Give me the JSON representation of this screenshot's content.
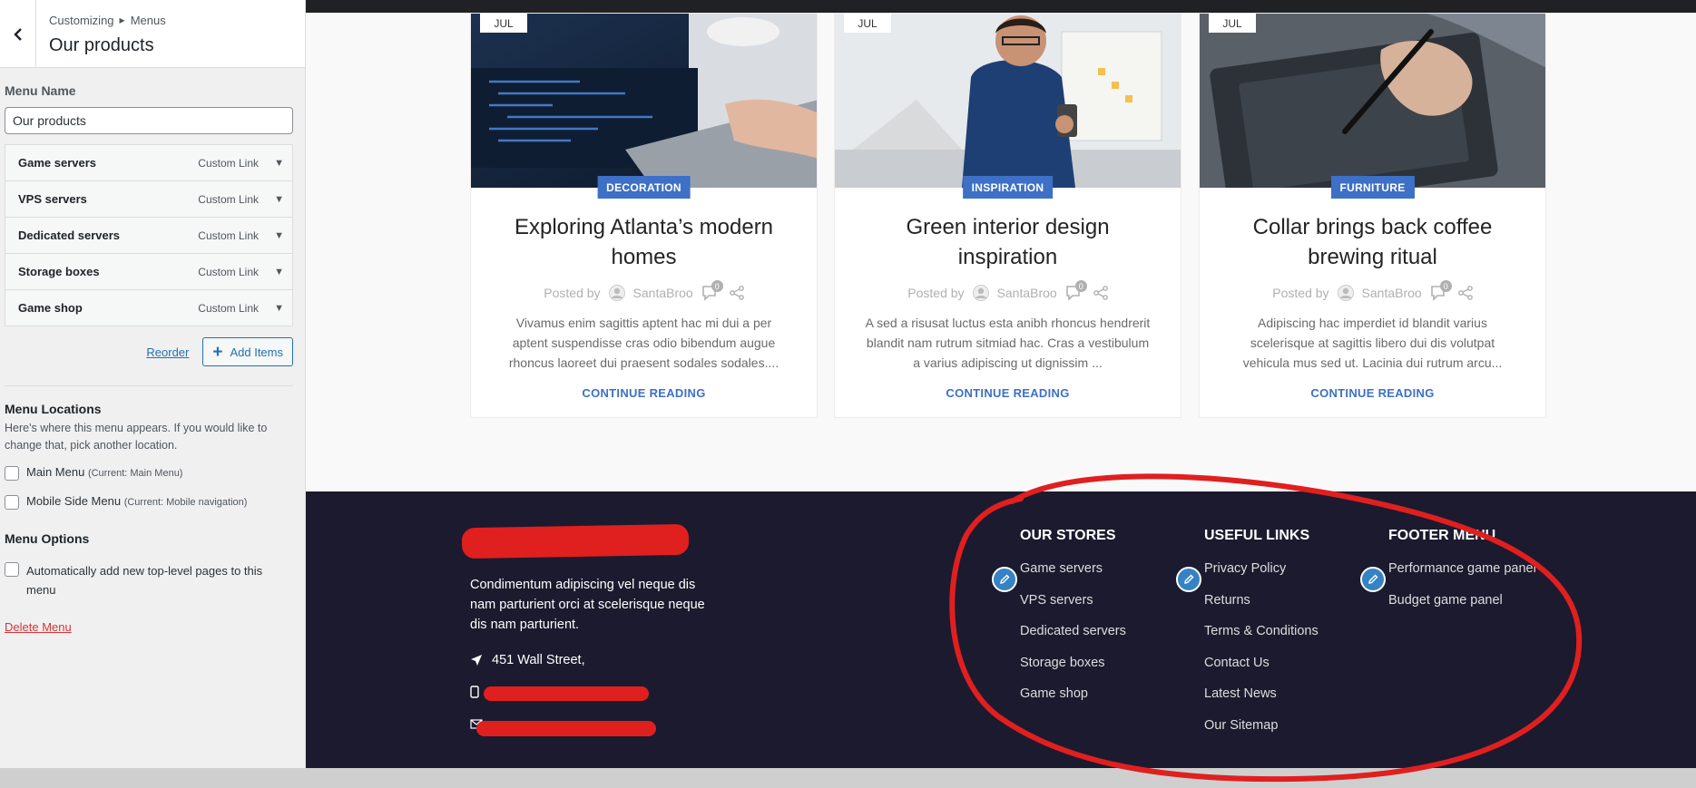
{
  "sidebar": {
    "breadcrumb": {
      "parent": "Customizing",
      "current": "Menus"
    },
    "title": "Our products",
    "menu_name_label": "Menu Name",
    "menu_name_value": "Our products",
    "items": [
      {
        "title": "Game servers",
        "type": "Custom Link"
      },
      {
        "title": "VPS servers",
        "type": "Custom Link"
      },
      {
        "title": "Dedicated servers",
        "type": "Custom Link"
      },
      {
        "title": "Storage boxes",
        "type": "Custom Link"
      },
      {
        "title": "Game shop",
        "type": "Custom Link"
      }
    ],
    "reorder_label": "Reorder",
    "add_items_label": "Add Items",
    "locations_title": "Menu Locations",
    "locations_desc": "Here's where this menu appears. If you would like to change that, pick another location.",
    "locations": [
      {
        "label": "Main Menu",
        "note": "(Current: Main Menu)"
      },
      {
        "label": "Mobile Side Menu",
        "note": "(Current: Mobile navigation)"
      }
    ],
    "options_title": "Menu Options",
    "auto_add_label": "Automatically add new top-level pages to this menu",
    "delete_label": "Delete Menu"
  },
  "posts": [
    {
      "date": "JUL",
      "category": "DECORATION",
      "title": "Exploring Atlanta’s modern homes",
      "posted_by": "Posted by",
      "author": "SantaBroo",
      "comments": "0",
      "excerpt": "Vivamus enim sagittis aptent hac mi dui a per aptent suspendisse cras odio bibendum augue rhoncus laoreet dui praesent sodales sodales....",
      "read_more": "CONTINUE READING"
    },
    {
      "date": "JUL",
      "category": "INSPIRATION",
      "title": "Green interior design inspiration",
      "posted_by": "Posted by",
      "author": "SantaBroo",
      "comments": "0",
      "excerpt": "A sed a risusat luctus esta anibh rhoncus hendrerit blandit nam rutrum sitmiad hac. Cras a vestibulum a varius adipiscing ut dignissim ...",
      "read_more": "CONTINUE READING"
    },
    {
      "date": "JUL",
      "category": "FURNITURE",
      "title": "Collar brings back coffee brewing ritual",
      "posted_by": "Posted by",
      "author": "SantaBroo",
      "comments": "0",
      "excerpt": "Adipiscing hac imperdiet id blandit varius scelerisque at sagittis libero dui dis volutpat vehicula mus sed ut. Lacinia dui rutrum arcu...",
      "read_more": "CONTINUE READING"
    }
  ],
  "footer": {
    "about": "Condimentum adipiscing vel neque dis nam parturient orci at scelerisque neque dis nam parturient.",
    "address": "451 Wall Street,",
    "columns": [
      {
        "title": "OUR STORES",
        "links": [
          "Game servers",
          "VPS servers",
          "Dedicated servers",
          "Storage boxes",
          "Game shop"
        ]
      },
      {
        "title": "USEFUL LINKS",
        "links": [
          "Privacy Policy",
          "Returns",
          "Terms & Conditions",
          "Contact Us",
          "Latest News",
          "Our Sitemap"
        ]
      },
      {
        "title": "FOOTER MENU",
        "links": [
          "Performance game panel",
          "Budget game panel"
        ]
      }
    ]
  },
  "colors": {
    "accent": "#3d70c6",
    "footer_bg": "#1c1a2e",
    "annotation": "#e01f1f",
    "wp_blue": "#2271b1",
    "delete_red": "#d63638"
  }
}
